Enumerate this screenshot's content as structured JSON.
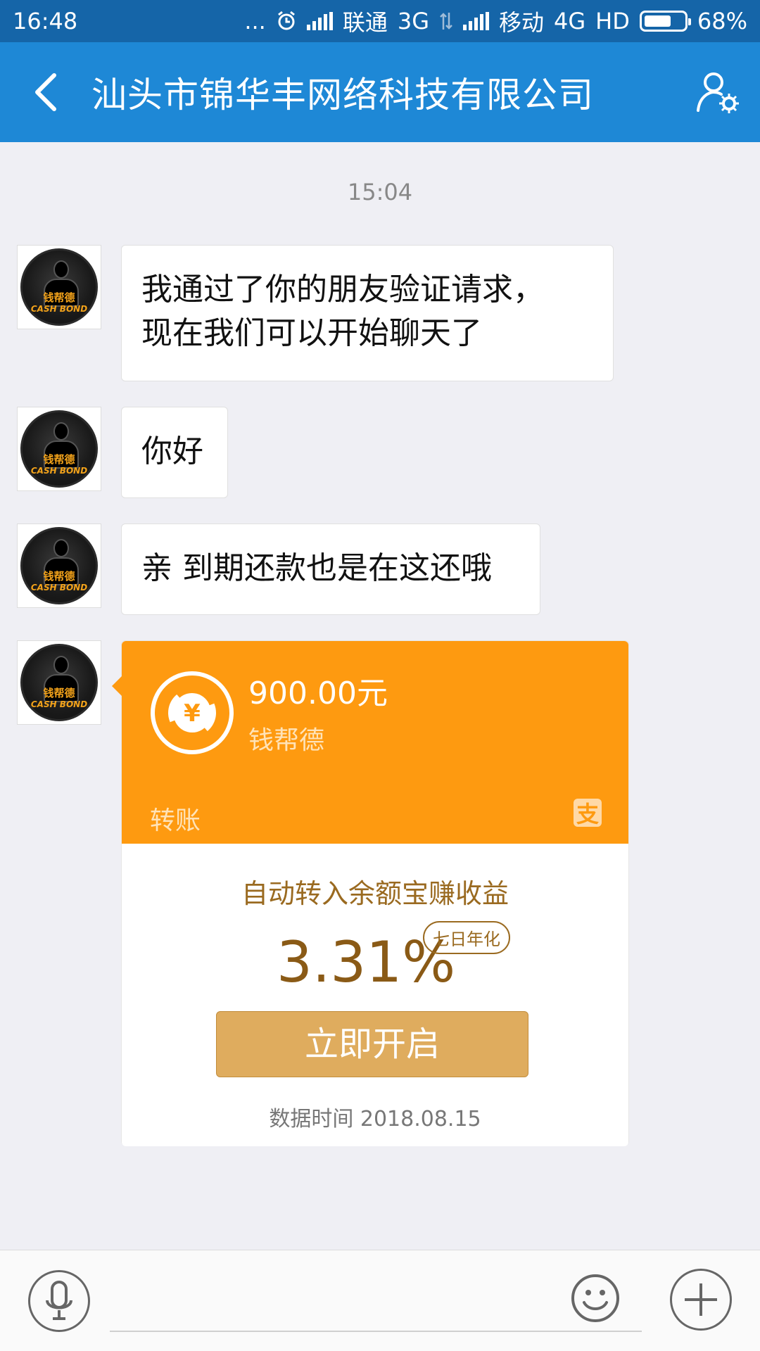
{
  "status_bar": {
    "time": "16:48",
    "more": "...",
    "carrier1": "联通",
    "net1": "3G",
    "carrier2": "移动",
    "net2": "4G",
    "hd": "HD",
    "battery": "68%",
    "battery_level": 0.68
  },
  "header": {
    "title": "汕头市锦华丰网络科技有限公司"
  },
  "chat": {
    "timestamp": "15:04",
    "messages": [
      {
        "line1": "我通过了你的朋友验证请求，",
        "line2": "现在我们可以开始聊天了"
      },
      {
        "text": "你好"
      },
      {
        "text": "亲 到期还款也是在这还哦"
      }
    ],
    "avatar_logo": "钱帮德",
    "avatar_sub": "CASH BOND"
  },
  "transfer": {
    "amount": "900.00元",
    "sender": "钱帮德",
    "type": "转账",
    "alipay_glyph": "支",
    "promo": "自动转入余额宝赚收益",
    "rate": "3.31%",
    "rate_badge": "七日年化",
    "button": "立即开启",
    "data_time": "数据时间 2018.08.15"
  },
  "input": {
    "placeholder": ""
  },
  "colors": {
    "status_bar": "#1565a8",
    "header": "#1e88d6",
    "transfer_orange": "#fe9a10",
    "button_gold": "#dfac5e"
  }
}
